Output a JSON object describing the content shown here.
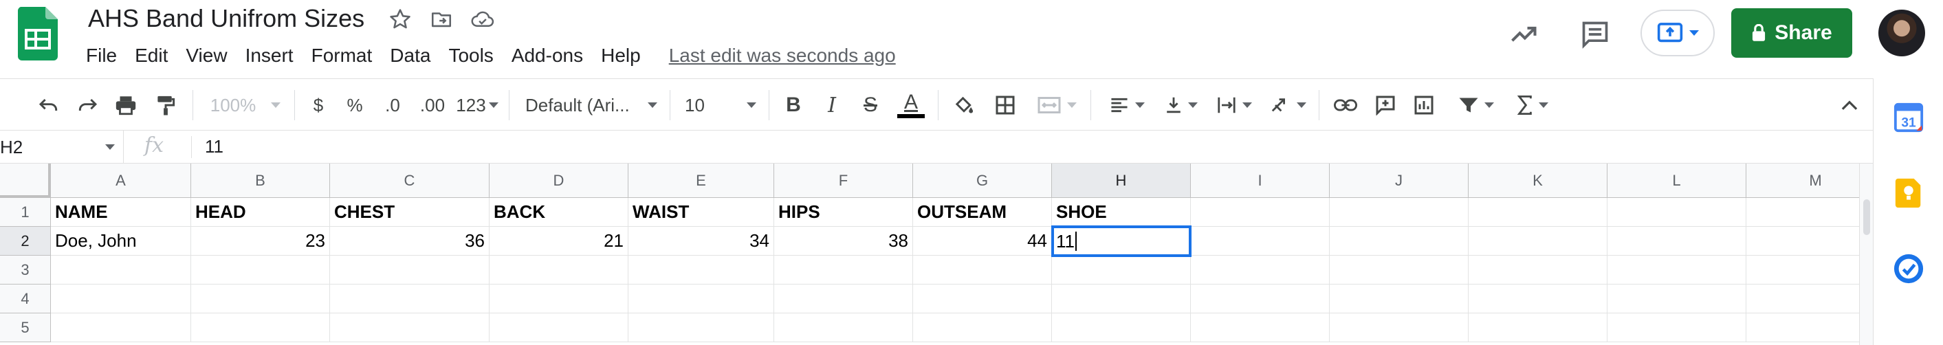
{
  "app": {
    "doc_title": "AHS Band Unifrom Sizes",
    "last_edit": "Last edit was seconds ago",
    "menu": [
      "File",
      "Edit",
      "View",
      "Insert",
      "Format",
      "Data",
      "Tools",
      "Add-ons",
      "Help"
    ],
    "share_label": "Share",
    "brand_color": "#0f9d58",
    "share_color": "#188038",
    "accent_color": "#1a73e8"
  },
  "toolbar": {
    "zoom": "100%",
    "currency": "$",
    "percent": "%",
    "decrease_decimal": ".0",
    "increase_decimal": ".00",
    "more_formats": "123",
    "font": "Default (Ari...",
    "font_size": "10",
    "bold": "B",
    "italic": "I",
    "strike": "S",
    "text_color": "A"
  },
  "formula_bar": {
    "name_box": "H2",
    "fx": "fx",
    "value": "11"
  },
  "grid": {
    "columns": [
      "A",
      "B",
      "C",
      "D",
      "E",
      "F",
      "G",
      "H",
      "I",
      "J",
      "K",
      "L",
      "M"
    ],
    "rows": [
      "1",
      "2",
      "3",
      "4",
      "5"
    ],
    "header_row": [
      "NAME",
      "HEAD",
      "CHEST",
      "BACK",
      "WAIST",
      "HIPS",
      "OUTSEAM",
      "SHOE"
    ],
    "data_row": [
      "Doe, John",
      "23",
      "36",
      "21",
      "34",
      "38",
      "44",
      "11"
    ],
    "selected_cell": "H2"
  },
  "icons": {
    "undo": "undo-icon",
    "redo": "redo-icon",
    "print": "print-icon",
    "paint_format": "paint-format-icon",
    "fill": "fill-color-icon",
    "borders": "borders-icon",
    "merge": "merge-cells-icon",
    "h_align": "horizontal-align-icon",
    "v_align": "vertical-align-icon",
    "wrap": "text-wrap-icon",
    "rotate": "text-rotation-icon",
    "link": "insert-link-icon",
    "comment": "insert-comment-icon",
    "chart": "insert-chart-icon",
    "filter": "filter-icon",
    "functions": "functions-icon"
  },
  "side_panel": {
    "calendar_day": "31"
  }
}
